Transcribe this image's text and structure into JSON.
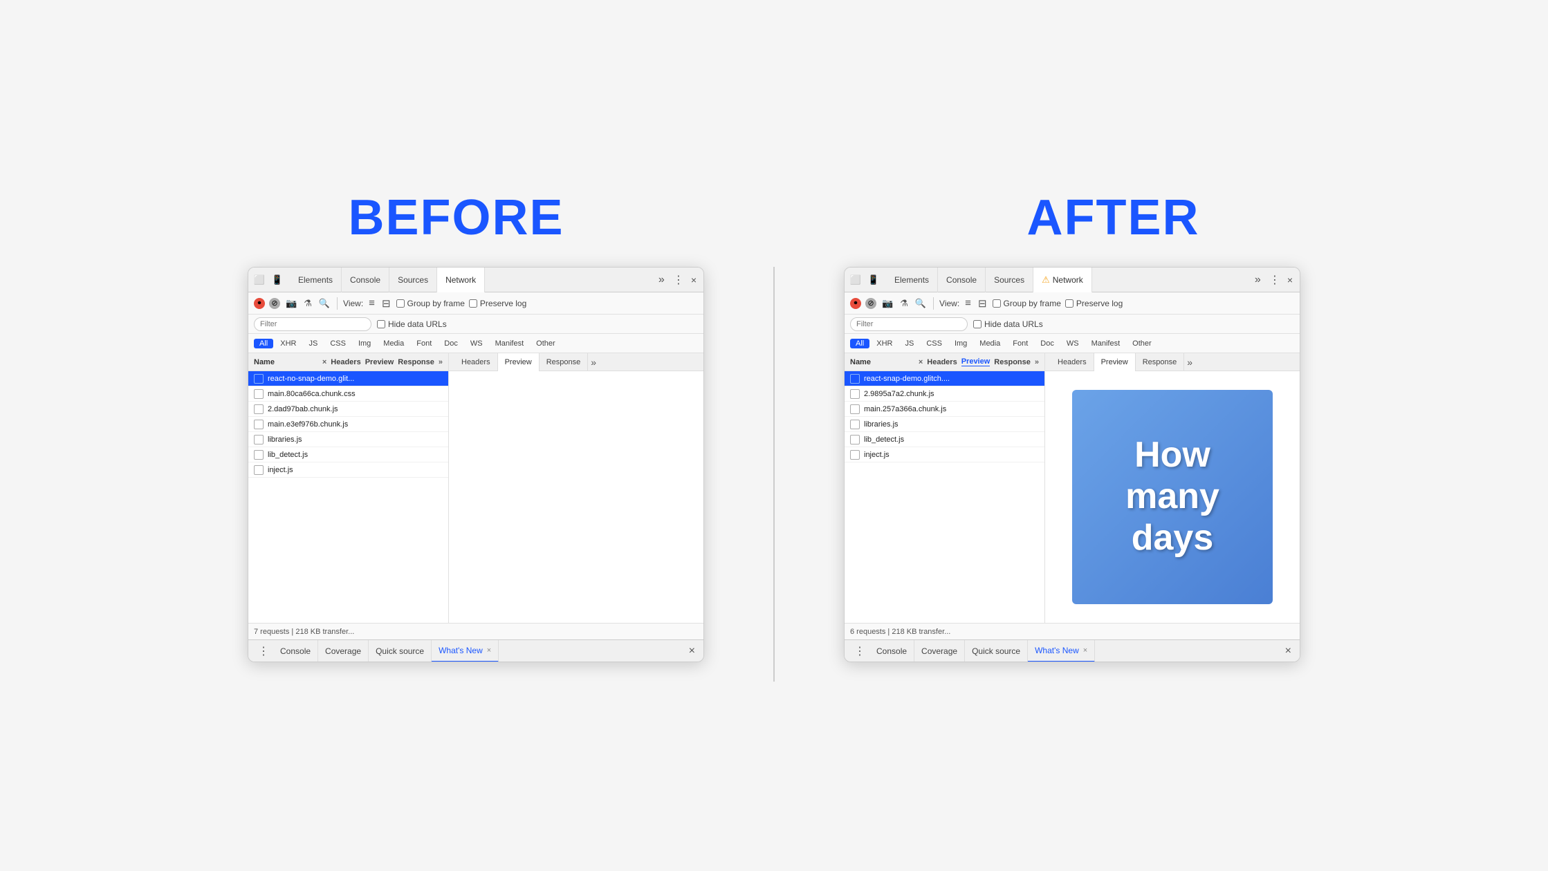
{
  "before_label": "BEFORE",
  "after_label": "AFTER",
  "before_panel": {
    "tabs": [
      "Elements",
      "Console",
      "Sources",
      "Network"
    ],
    "active_tab": "Network",
    "more": "»",
    "close": "×",
    "toolbar": {
      "view_label": "View:",
      "group_by_frame": "Group by frame",
      "preserve_log": "Preserve log"
    },
    "filter_placeholder": "Filter",
    "hide_data_urls": "Hide data URLs",
    "type_filters": [
      "All",
      "XHR",
      "JS",
      "CSS",
      "Img",
      "Media",
      "Font",
      "Doc",
      "WS",
      "Manifest",
      "Other"
    ],
    "active_type": "All",
    "col_header_name": "Name",
    "col_header_x": "×",
    "files": [
      {
        "name": "react-no-snap-demo.glit...",
        "selected": true
      },
      {
        "name": "main.80ca66ca.chunk.css",
        "selected": false
      },
      {
        "name": "2.dad97bab.chunk.js",
        "selected": false
      },
      {
        "name": "main.e3ef976b.chunk.js",
        "selected": false
      },
      {
        "name": "libraries.js",
        "selected": false
      },
      {
        "name": "lib_detect.js",
        "selected": false
      },
      {
        "name": "inject.js",
        "selected": false
      }
    ],
    "preview_tabs": [
      "Headers",
      "Preview",
      "Response"
    ],
    "active_preview_tab": "Preview",
    "preview_content": "blank",
    "status": "7 requests | 218 KB transfer...",
    "bottom_tabs": [
      "Console",
      "Coverage",
      "Quick source",
      "What's New"
    ],
    "active_bottom_tab": "What's New"
  },
  "after_panel": {
    "tabs": [
      "Elements",
      "Console",
      "Sources",
      "Network"
    ],
    "active_tab": "Network",
    "has_warning": true,
    "more": "»",
    "close": "×",
    "toolbar": {
      "view_label": "View:",
      "group_by_frame": "Group by frame",
      "preserve_log": "Preserve log"
    },
    "filter_placeholder": "Filter",
    "hide_data_urls": "Hide data URLs",
    "type_filters": [
      "All",
      "XHR",
      "JS",
      "CSS",
      "Img",
      "Media",
      "Font",
      "Doc",
      "WS",
      "Manifest",
      "Other"
    ],
    "active_type": "All",
    "col_header_name": "Name",
    "col_header_x": "×",
    "files": [
      {
        "name": "react-snap-demo.glitch....",
        "selected": true
      },
      {
        "name": "2.9895a7a2.chunk.js",
        "selected": false
      },
      {
        "name": "main.257a366a.chunk.js",
        "selected": false
      },
      {
        "name": "libraries.js",
        "selected": false
      },
      {
        "name": "lib_detect.js",
        "selected": false
      },
      {
        "name": "inject.js",
        "selected": false
      }
    ],
    "preview_tabs": [
      "Headers",
      "Preview",
      "Response"
    ],
    "active_preview_tab": "Preview",
    "preview_text": "How\nmany\ndays",
    "preview_gradient_start": "#6ba3e8",
    "preview_gradient_end": "#4a7fd4",
    "status": "6 requests | 218 KB transfer...",
    "bottom_tabs": [
      "Console",
      "Coverage",
      "Quick source",
      "What's New"
    ],
    "active_bottom_tab": "What's New"
  },
  "icons": {
    "record": "⏺",
    "cancel": "🚫",
    "camera": "📷",
    "filter_icon": "⚗",
    "search": "🔍",
    "grid_icon": "▦",
    "grid_icon2": "⋮⋮",
    "more_dots": "⋮",
    "warn": "⚠"
  }
}
